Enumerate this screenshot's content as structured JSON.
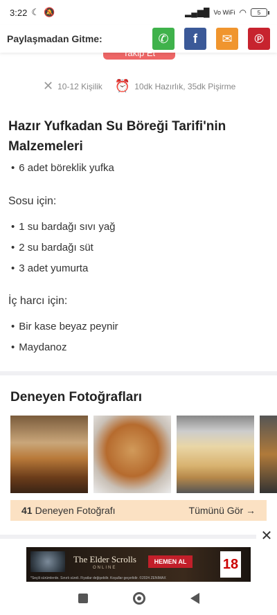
{
  "status": {
    "time": "3:22",
    "network": "Vo WiFi",
    "battery": "5"
  },
  "share": {
    "title": "Paylaşmadan Gitme:",
    "buttons": [
      {
        "name": "whatsapp",
        "color": "#3fb24b",
        "glyph": "✆"
      },
      {
        "name": "facebook",
        "color": "#3b5998",
        "glyph": "f"
      },
      {
        "name": "email",
        "color": "#f0952e",
        "glyph": "✉"
      },
      {
        "name": "pinterest",
        "color": "#c7232e",
        "glyph": "℗"
      }
    ]
  },
  "follow_label": "Takip Et",
  "meta": {
    "servings": "10-12 Kişilik",
    "time": "10dk Hazırlık, 35dk Pişirme"
  },
  "ingredients_title": "Hazır Yufkadan Su Böreği Tarifi'nin Malzemeleri",
  "main_list": [
    "6 adet böreklik yufka"
  ],
  "sauce_title": "Sosu için:",
  "sauce_list": [
    "1 su bardağı sıvı yağ",
    "2 su bardağı süt",
    "3 adet yumurta"
  ],
  "filling_title": "İç harcı için:",
  "filling_list": [
    "Bir kase beyaz peynir",
    "Maydanoz"
  ],
  "photos": {
    "title": "Deneyen Fotoğrafları",
    "count": "41",
    "count_label": "Deneyen Fotoğrafı",
    "see_all": "Tümünü Gör →"
  },
  "ad": {
    "brand": "The Elder Scrolls",
    "sub": "ONLINE",
    "cta": "HEMEN AL",
    "rating": "18",
    "small": "*Seçili sürümlerde. Sınırlı süreli. Fiyatlar değişebilir. Koşullar geçerlidir. ©2024 ZENIMAX"
  },
  "colors": {
    "accent": "#e66666",
    "photos_bar": "#fbe1c3"
  }
}
